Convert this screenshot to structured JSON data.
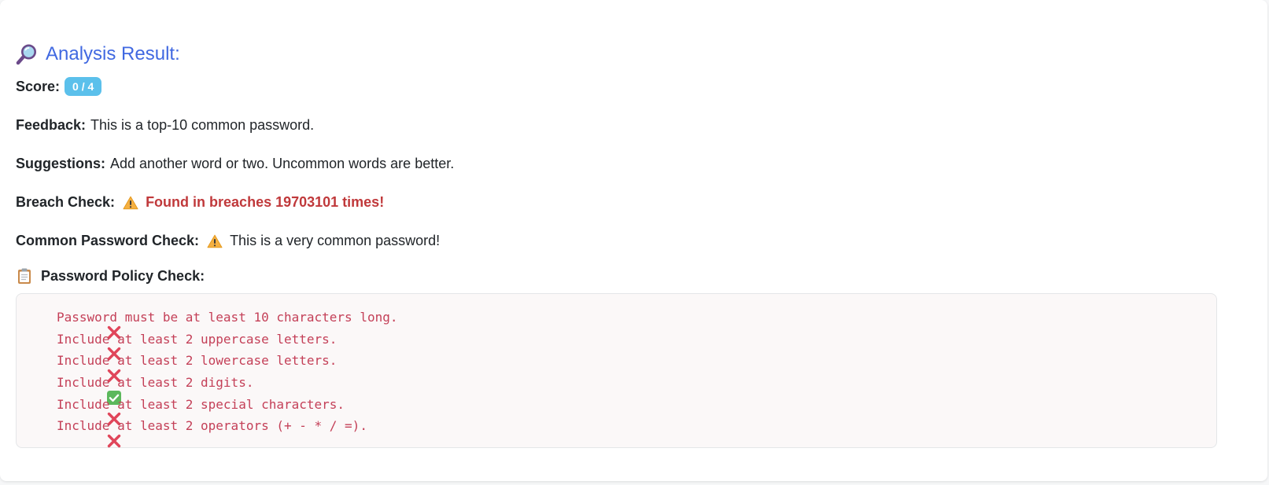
{
  "result": {
    "title": "Analysis Result:",
    "icon": "magnifying-glass-icon",
    "score_label": "Score:",
    "score_value": "0 / 4",
    "feedback_label": "Feedback:",
    "feedback_text": "This is a top-10 common password.",
    "suggestions_label": "Suggestions:",
    "suggestions_text": "Add another word or two. Uncommon words are better.",
    "breach_label": "Breach Check:",
    "breach_text": "Found in breaches 19703101 times!",
    "common_label": "Common Password Check:",
    "common_text": "This is a very common password!",
    "colors": {
      "accent": "#4169e1",
      "badge": "#5bc0eb",
      "danger": "#c0393b",
      "policy_text": "#c44058"
    }
  },
  "policy": {
    "title": "Password Policy Check:",
    "icon": "clipboard-icon",
    "items": [
      {
        "status": "fail",
        "icon": "cross-mark-icon",
        "text": "Password must be at least 10 characters long."
      },
      {
        "status": "fail",
        "icon": "cross-mark-icon",
        "text": "Include at least 2 uppercase letters."
      },
      {
        "status": "fail",
        "icon": "cross-mark-icon",
        "text": "Include at least 2 lowercase letters."
      },
      {
        "status": "pass",
        "icon": "check-mark-icon",
        "text": "Include at least 2 digits."
      },
      {
        "status": "fail",
        "icon": "cross-mark-icon",
        "text": "Include at least 2 special characters."
      },
      {
        "status": "fail",
        "icon": "cross-mark-icon",
        "text": "Include at least 2 operators (+ - * / =)."
      }
    ]
  }
}
